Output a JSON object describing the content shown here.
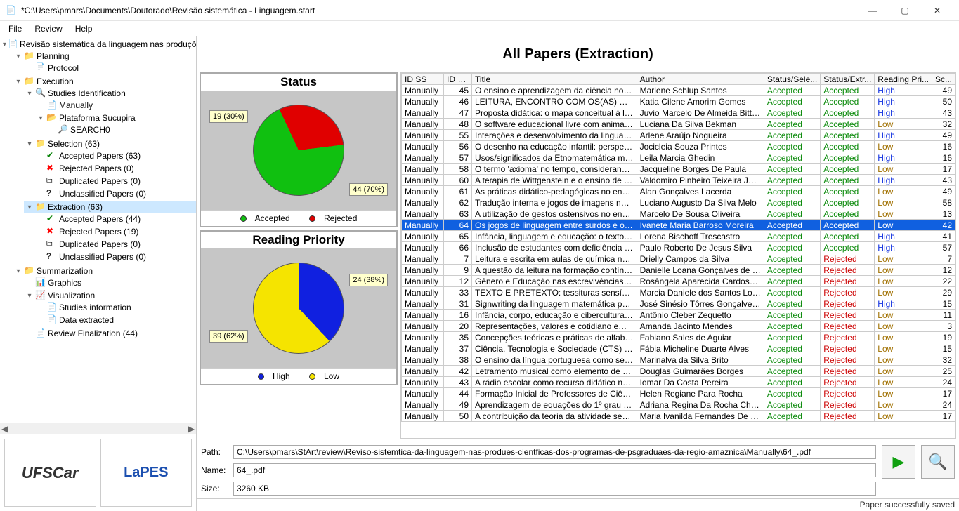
{
  "window": {
    "title": "*C:\\Users\\pmars\\Documents\\Doutorado\\Revisão sistemática - Linguagem.start",
    "min": "—",
    "max": "▢",
    "close": "✕"
  },
  "menu": {
    "file": "File",
    "review": "Review",
    "help": "Help"
  },
  "tree": {
    "root": "Revisão sistemática da linguagem nas produções cie",
    "planning": "Planning",
    "protocol": "Protocol",
    "execution": "Execution",
    "studies_id": "Studies Identification",
    "manually": "Manually",
    "sucupira": "Plataforma Sucupira",
    "search0": "SEARCH0",
    "selection": "Selection (63)",
    "sel_acc": "Accepted Papers (63)",
    "sel_rej": "Rejected Papers (0)",
    "sel_dup": "Duplicated Papers (0)",
    "sel_unc": "Unclassified Papers (0)",
    "extraction": "Extraction (63)",
    "ext_acc": "Accepted Papers (44)",
    "ext_rej": "Rejected Papers (19)",
    "ext_dup": "Duplicated Papers (0)",
    "ext_unc": "Unclassified Papers (0)",
    "summarization": "Summarization",
    "graphics": "Graphics",
    "visualization": "Visualization",
    "studies_info": "Studies information",
    "data_ext": "Data extracted",
    "review_fin": "Review Finalization (44)"
  },
  "logos": {
    "ufscar": "UFSCar",
    "lapes": "LaPES"
  },
  "page_title": "All Papers (Extraction)",
  "chart_data": [
    {
      "type": "pie",
      "title": "Status",
      "series": [
        {
          "name": "Accepted",
          "value": 44,
          "pct": 70,
          "color": "#10c010"
        },
        {
          "name": "Rejected",
          "value": 19,
          "pct": 30,
          "color": "#e00000"
        }
      ],
      "callouts": {
        "a": "44\n(70%)",
        "b": "19\n(30%)"
      },
      "legend": [
        "Accepted",
        "Rejected"
      ]
    },
    {
      "type": "pie",
      "title": "Reading Priority",
      "series": [
        {
          "name": "High",
          "value": 24,
          "pct": 38,
          "color": "#1020e0"
        },
        {
          "name": "Low",
          "value": 39,
          "pct": 62,
          "color": "#f5e400"
        }
      ],
      "callouts": {
        "a": "24\n(38%)",
        "b": "39\n(62%)"
      },
      "legend": [
        "High",
        "Low"
      ]
    }
  ],
  "table": {
    "headers": {
      "idss": "ID SS",
      "idp": "ID P...",
      "title": "Title",
      "author": "Author",
      "ssel": "Status/Sele...",
      "sext": "Status/Extr...",
      "pri": "Reading Pri...",
      "sc": "Sc..."
    },
    "rows": [
      {
        "idss": "Manually",
        "idp": 45,
        "title": "O ensino e aprendizagem da ciência no ensi...",
        "author": "Marlene Schlup Santos",
        "ssel": "Accepted",
        "sext": "Accepted",
        "pri": "High",
        "sc": 49
      },
      {
        "idss": "Manually",
        "idp": 46,
        "title": "LEITURA, ENCONTRO COM OS(AS) OUTRO...",
        "author": "Katia Cilene Amorim Gomes",
        "ssel": "Accepted",
        "sext": "Accepted",
        "pri": "High",
        "sc": 50
      },
      {
        "idss": "Manually",
        "idp": 47,
        "title": "Proposta didática: o mapa conceitual à luz d...",
        "author": "Juvio Marcelo De Almeida Bittenc...",
        "ssel": "Accepted",
        "sext": "Accepted",
        "pri": "High",
        "sc": 43
      },
      {
        "idss": "Manually",
        "idp": 48,
        "title": "O software educacional livre com animação i...",
        "author": "Luciana Da Silva Bekman",
        "ssel": "Accepted",
        "sext": "Accepted",
        "pri": "Low",
        "sc": 32
      },
      {
        "idss": "Manually",
        "idp": 55,
        "title": "Interações e desenvolvimento da linguagem...",
        "author": "Arlene Araújo Nogueira",
        "ssel": "Accepted",
        "sext": "Accepted",
        "pri": "High",
        "sc": 49
      },
      {
        "idss": "Manually",
        "idp": 56,
        "title": "O desenho na educação infantil: perspectiv...",
        "author": "Jocicleia Souza Printes",
        "ssel": "Accepted",
        "sext": "Accepted",
        "pri": "Low",
        "sc": 16
      },
      {
        "idss": "Manually",
        "idp": 57,
        "title": "Usos/significados da Etnomatemática mobiliz...",
        "author": "Leila Marcia Ghedin",
        "ssel": "Accepted",
        "sext": "Accepted",
        "pri": "High",
        "sc": 16
      },
      {
        "idss": "Manually",
        "idp": 58,
        "title": "O termo 'axioma' no tempo, considerando a ...",
        "author": "Jacqueline Borges De Paula",
        "ssel": "Accepted",
        "sext": "Accepted",
        "pri": "Low",
        "sc": 17
      },
      {
        "idss": "Manually",
        "idp": 60,
        "title": "A terapia de Wittgenstein e o ensino de álge...",
        "author": "Valdomiro Pinheiro Teixeira Junior",
        "ssel": "Accepted",
        "sext": "Accepted",
        "pri": "High",
        "sc": 43
      },
      {
        "idss": "Manually",
        "idp": 61,
        "title": "As práticas didático-pedagógicas no ensino ...",
        "author": "Alan Gonçalves Lacerda",
        "ssel": "Accepted",
        "sext": "Accepted",
        "pri": "Low",
        "sc": 49
      },
      {
        "idss": "Manually",
        "idp": 62,
        "title": "Tradução interna e jogos de imagens na mat...",
        "author": "Luciano Augusto Da Silva Melo",
        "ssel": "Accepted",
        "sext": "Accepted",
        "pri": "Low",
        "sc": 58
      },
      {
        "idss": "Manually",
        "idp": 63,
        "title": "A utilização de gestos ostensivos no ensino ...",
        "author": "Marcelo De Sousa Oliveira",
        "ssel": "Accepted",
        "sext": "Accepted",
        "pri": "Low",
        "sc": 13
      },
      {
        "idss": "Manually",
        "idp": 64,
        "title": "Os jogos de linguagem entre surdos e ouvin...",
        "author": "Ivanete Maria Barroso Moreira",
        "ssel": "Accepted",
        "sext": "Accepted",
        "pri": "Low",
        "sc": 42,
        "sel": true
      },
      {
        "idss": "Manually",
        "idp": 65,
        "title": "Infância, linguagem e educação: o texto esc...",
        "author": "Lorena Bischoff Trescastro",
        "ssel": "Accepted",
        "sext": "Accepted",
        "pri": "High",
        "sc": 41
      },
      {
        "idss": "Manually",
        "idp": 66,
        "title": "Inclusão de estudantes com deficiência visu...",
        "author": "Paulo Roberto De Jesus Silva",
        "ssel": "Accepted",
        "sext": "Accepted",
        "pri": "High",
        "sc": 57
      },
      {
        "idss": "Manually",
        "idp": 7,
        "title": "Leitura e escrita em aulas de química no ensi...",
        "author": "Drielly Campos da Silva",
        "ssel": "Accepted",
        "sext": "Rejected",
        "pri": "Low",
        "sc": 7
      },
      {
        "idss": "Manually",
        "idp": 9,
        "title": "A questão da leitura na formação contínua d...",
        "author": "Danielle Loana Gonçalves de Souza",
        "ssel": "Accepted",
        "sext": "Rejected",
        "pri": "Low",
        "sc": 12
      },
      {
        "idss": "Manually",
        "idp": 12,
        "title": "Gênero e Educação nas escrevivências de c...",
        "author": "Rosângela Aparecida Cardoso d...",
        "ssel": "Accepted",
        "sext": "Rejected",
        "pri": "Low",
        "sc": 22
      },
      {
        "idss": "Manually",
        "idp": 33,
        "title": "TEXTO E PRETEXTO: tessituras sensíveis de ...",
        "author": "Marcia Daniele dos Santos Lobato",
        "ssel": "Accepted",
        "sext": "Rejected",
        "pri": "Low",
        "sc": 29
      },
      {
        "idss": "Manually",
        "idp": 31,
        "title": "Signwriting da linguagem matemática para o ...",
        "author": "José Sinésio Tôrres Gonçalves Filho",
        "ssel": "Accepted",
        "sext": "Rejected",
        "pri": "High",
        "sc": 15
      },
      {
        "idss": "Manually",
        "idp": 16,
        "title": "Infância, corpo, educação e cibercultura: cri...",
        "author": "Antônio Cleber Zequetto",
        "ssel": "Accepted",
        "sext": "Rejected",
        "pri": "Low",
        "sc": 11
      },
      {
        "idss": "Manually",
        "idp": 20,
        "title": "Representações, valores e cotidiano em nar...",
        "author": "Amanda Jacinto Mendes",
        "ssel": "Accepted",
        "sext": "Rejected",
        "pri": "Low",
        "sc": 3
      },
      {
        "idss": "Manually",
        "idp": 35,
        "title": "Concepções teóricas e práticas de alfabetiz...",
        "author": "Fabiano Sales de Aguiar",
        "ssel": "Accepted",
        "sext": "Rejected",
        "pri": "Low",
        "sc": 19
      },
      {
        "idss": "Manually",
        "idp": 37,
        "title": "Ciência, Tecnologia e Sociedade (CTS) nos C...",
        "author": "Fábia Micheline Duarte Alves",
        "ssel": "Accepted",
        "sext": "Rejected",
        "pri": "Low",
        "sc": 15
      },
      {
        "idss": "Manually",
        "idp": 38,
        "title": "O ensino da língua portuguesa como segund...",
        "author": "Marinalva da Silva Brito",
        "ssel": "Accepted",
        "sext": "Rejected",
        "pri": "Low",
        "sc": 32
      },
      {
        "idss": "Manually",
        "idp": 42,
        "title": "Letramento musical como elemento de auxili...",
        "author": "Douglas Guimarães Borges",
        "ssel": "Accepted",
        "sext": "Rejected",
        "pri": "Low",
        "sc": 25
      },
      {
        "idss": "Manually",
        "idp": 43,
        "title": "A rádio escolar como recurso didático no ens...",
        "author": "Iomar Da Costa Pereira",
        "ssel": "Accepted",
        "sext": "Rejected",
        "pri": "Low",
        "sc": 24
      },
      {
        "idss": "Manually",
        "idp": 44,
        "title": "Formação Inicial de Professores de Ciências:...",
        "author": "Helen Regiane Para Rocha",
        "ssel": "Accepted",
        "sext": "Rejected",
        "pri": "Low",
        "sc": 17
      },
      {
        "idss": "Manually",
        "idp": 49,
        "title": "Aprendizagem de equações do 1º grau a pa...",
        "author": "Adriana Regina Da Rocha Chirone",
        "ssel": "Accepted",
        "sext": "Rejected",
        "pri": "Low",
        "sc": 24
      },
      {
        "idss": "Manually",
        "idp": 50,
        "title": "A contribuição da teoria da atividade segun...",
        "author": "Maria Ivanilda Fernandes De Lac...",
        "ssel": "Accepted",
        "sext": "Rejected",
        "pri": "Low",
        "sc": 17
      }
    ]
  },
  "footer": {
    "path_label": "Path:",
    "path": "C:\\Users\\pmars\\StArt\\review\\Reviso-sistemtica-da-linguagem-nas-produes-cientficas-dos-programas-de-psgraduaes-da-regio-amaznica\\Manually\\64_.pdf",
    "name_label": "Name:",
    "name": "64_.pdf",
    "size_label": "Size:",
    "size": "3260 KB",
    "play": "▶",
    "search": "🔍"
  },
  "status": "Paper successfully saved"
}
